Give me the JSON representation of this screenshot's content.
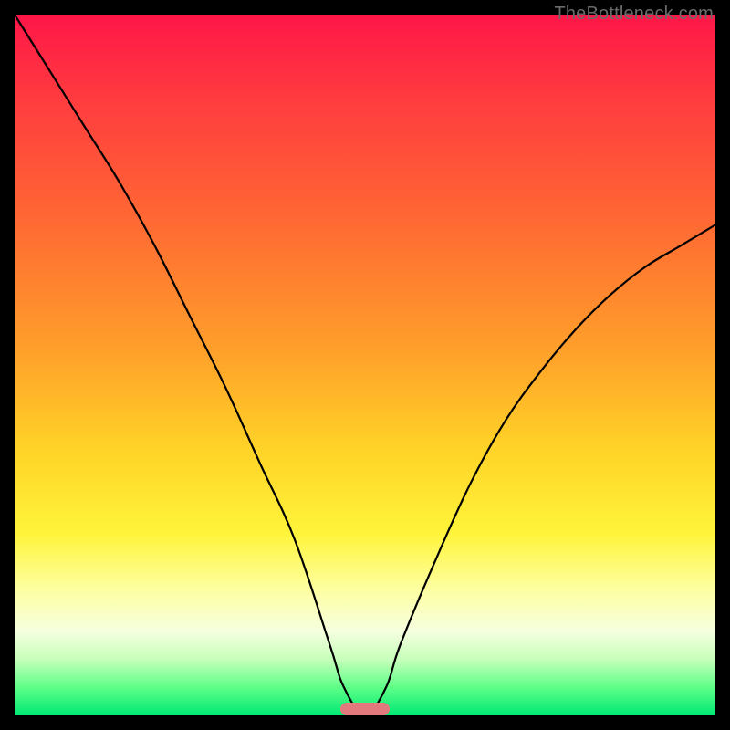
{
  "watermark": {
    "text": "TheBottleneck.com"
  },
  "colors": {
    "curve_stroke": "#000000",
    "marker_fill": "#e2797c",
    "frame": "#000000"
  },
  "chart_data": {
    "type": "line",
    "title": "",
    "xlabel": "",
    "ylabel": "",
    "xlim": [
      0,
      100
    ],
    "ylim": [
      0,
      100
    ],
    "grid": false,
    "legend": false,
    "series": [
      {
        "name": "bottleneck-curve",
        "x": [
          0,
          5,
          10,
          15,
          20,
          25,
          30,
          35,
          40,
          45,
          47,
          50,
          53,
          55,
          60,
          65,
          70,
          75,
          80,
          85,
          90,
          95,
          100
        ],
        "y": [
          100,
          92,
          84,
          76,
          67,
          57,
          47,
          36,
          25,
          10,
          4,
          0,
          4,
          10,
          22,
          33,
          42,
          49,
          55,
          60,
          64,
          67,
          70
        ]
      }
    ],
    "annotations": [
      {
        "name": "optimal-marker",
        "x": 50,
        "y": 0,
        "width_pct": 7
      }
    ]
  }
}
